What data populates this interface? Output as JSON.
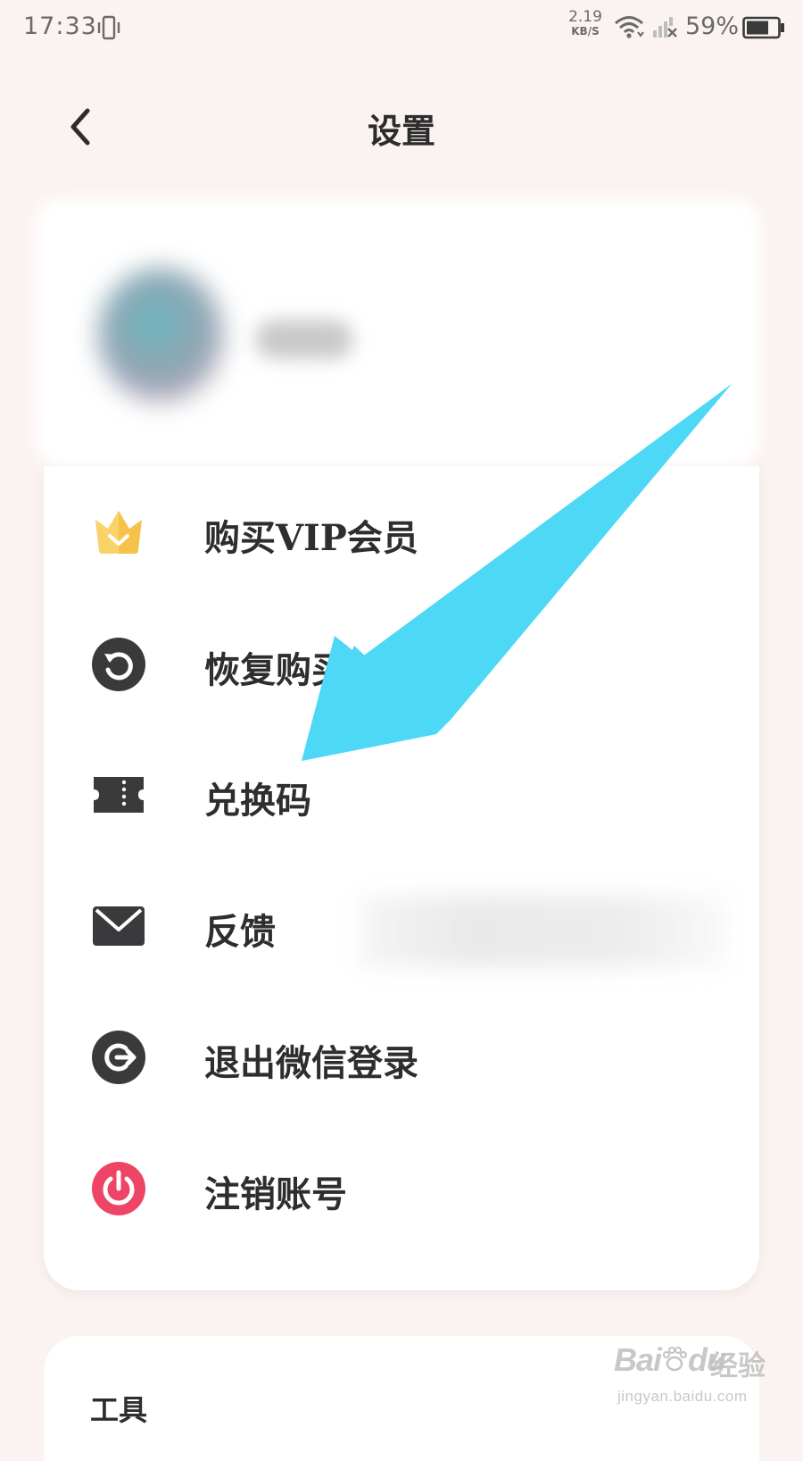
{
  "status_bar": {
    "time": "17:33",
    "net_speed_value": "2.19",
    "net_speed_unit": "KB/S",
    "battery_percent": "59%"
  },
  "header": {
    "title": "设置"
  },
  "menu": {
    "items": [
      {
        "label": "购买VIP会员",
        "icon": "crown-icon",
        "icon_color": "#f7c24a"
      },
      {
        "label": "恢复购买",
        "icon": "restore-icon",
        "icon_color": "#3a3a3c"
      },
      {
        "label": "兑换码",
        "icon": "ticket-icon",
        "icon_color": "#3a3a3c"
      },
      {
        "label": "反馈",
        "icon": "mail-icon",
        "icon_color": "#3a3a3c"
      },
      {
        "label": "退出微信登录",
        "icon": "logout-icon",
        "icon_color": "#3a3a3c"
      },
      {
        "label": "注销账号",
        "icon": "power-icon",
        "icon_color": "#ee4466"
      }
    ]
  },
  "tools": {
    "title": "工具"
  },
  "annotation": {
    "arrow_color": "#4dd8f5"
  },
  "watermark": {
    "logo": "Bai",
    "logo_tail": "du",
    "name": "经验",
    "url": "jingyan.baidu.com"
  }
}
